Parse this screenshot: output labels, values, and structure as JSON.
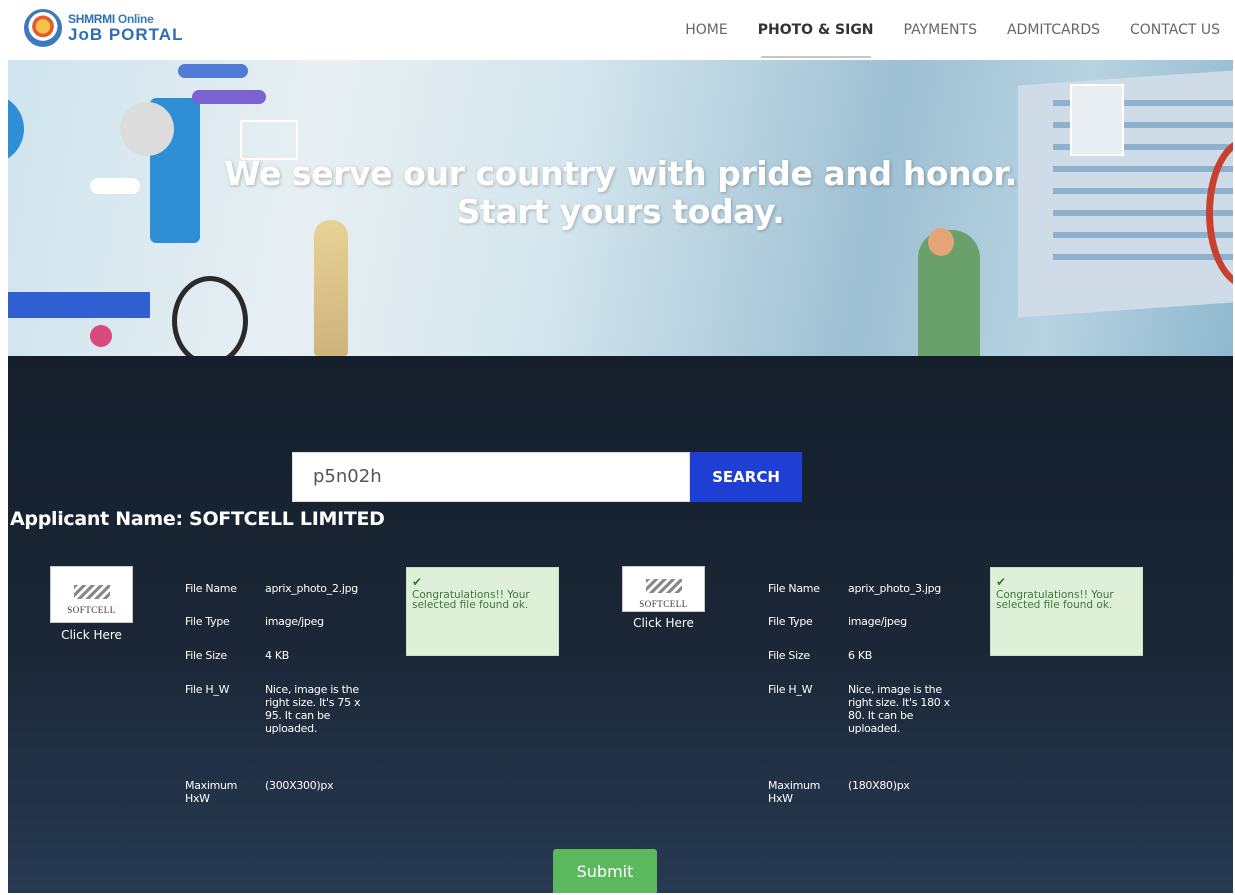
{
  "logo": {
    "line1_a": "SHMRMI ",
    "line1_b": "Online",
    "line2": "JoB PORTAL"
  },
  "nav": {
    "items": [
      "HOME",
      "PHOTO & SIGN",
      "PAYMENTS",
      "ADMITCARDS",
      "CONTACT US"
    ],
    "active": "PHOTO & SIGN"
  },
  "hero": {
    "line1": "We serve our country with pride and honor.",
    "line2": "Start yours today."
  },
  "search": {
    "value": "p5n02h",
    "button_label": "SEARCH"
  },
  "applicant_label": "Applicant Name: SOFTCELL LIMITED",
  "files": [
    {
      "thumb_name": "SOFTCELL",
      "click_label": "Click Here",
      "labels": {
        "name": "File Name",
        "type": "File Type",
        "size": "File Size",
        "hw": "File H_W",
        "max": "Maximum HxW"
      },
      "name": "aprix_photo_2.jpg",
      "type": "image/jpeg",
      "size": "4 KB",
      "hw": "Nice, image is the right size. It's 75 x 95. It can be uploaded.",
      "max": "(300X300)px",
      "message_check": "✔",
      "message": "Congratulations!! Your selected file found ok."
    },
    {
      "thumb_name": "SOFTCELL",
      "click_label": "Click Here",
      "labels": {
        "name": "File Name",
        "type": "File Type",
        "size": "File Size",
        "hw": "File H_W",
        "max": "Maximum HxW"
      },
      "name": "aprix_photo_3.jpg",
      "type": "image/jpeg",
      "size": "6 KB",
      "hw": "Nice, image is the right size. It's 180 x 80. It can be uploaded.",
      "max": "(180X80)px",
      "message_check": "✔",
      "message": "Congratulations!! Your selected file found ok."
    }
  ],
  "submit_label": "Submit",
  "colors": {
    "search_button": "#1f3ed4",
    "submit_button": "#5cb85c",
    "dark_bg": "#1b2737",
    "success_bg": "#dff0d8"
  }
}
